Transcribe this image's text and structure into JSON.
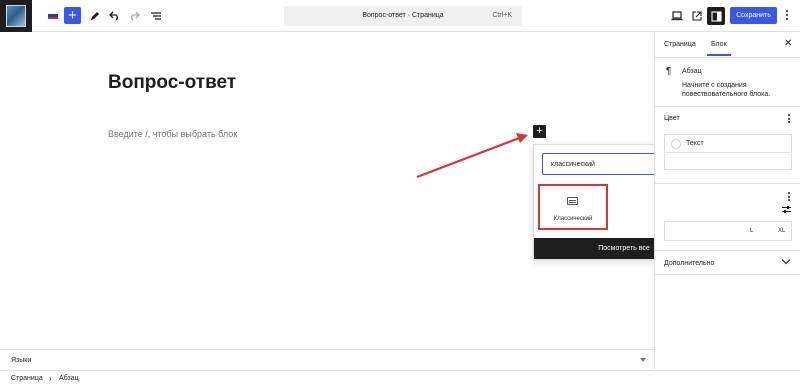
{
  "toolbar": {
    "command_palette_title": "Вопрос-ответ · Страница",
    "command_palette_shortcut": "Ctrl+K",
    "save_label": "Сохранить",
    "add_symbol": "+",
    "flag_colors": [
      "#ffffff",
      "#1c3fbf",
      "#d52b1e"
    ]
  },
  "editor": {
    "page_title": "Вопрос-ответ",
    "placeholder": "Введите /, чтобы выбрать блок",
    "inline_add_symbol": "+"
  },
  "inserter": {
    "search_value": "классический",
    "clear_symbol": "✕",
    "result_label": "Классический",
    "view_all_label": "Посмотреть все"
  },
  "sidebar": {
    "tabs": [
      "Страница",
      "Блок"
    ],
    "active_tab": "Блок",
    "close_symbol": "✕",
    "block_icon": "¶",
    "block_name": "Абзац",
    "block_description": "Начните с создания повествовательного блока.",
    "color_section_title": "Цвет",
    "color_text_label": "Текст",
    "size_options": [
      "L",
      "XL"
    ],
    "advanced_label": "Дополнительно"
  },
  "languages_label": "Языки",
  "breadcrumb": [
    "Страница",
    "Абзац"
  ],
  "colors": {
    "accent": "#3858e9",
    "highlight": "#d63638"
  }
}
